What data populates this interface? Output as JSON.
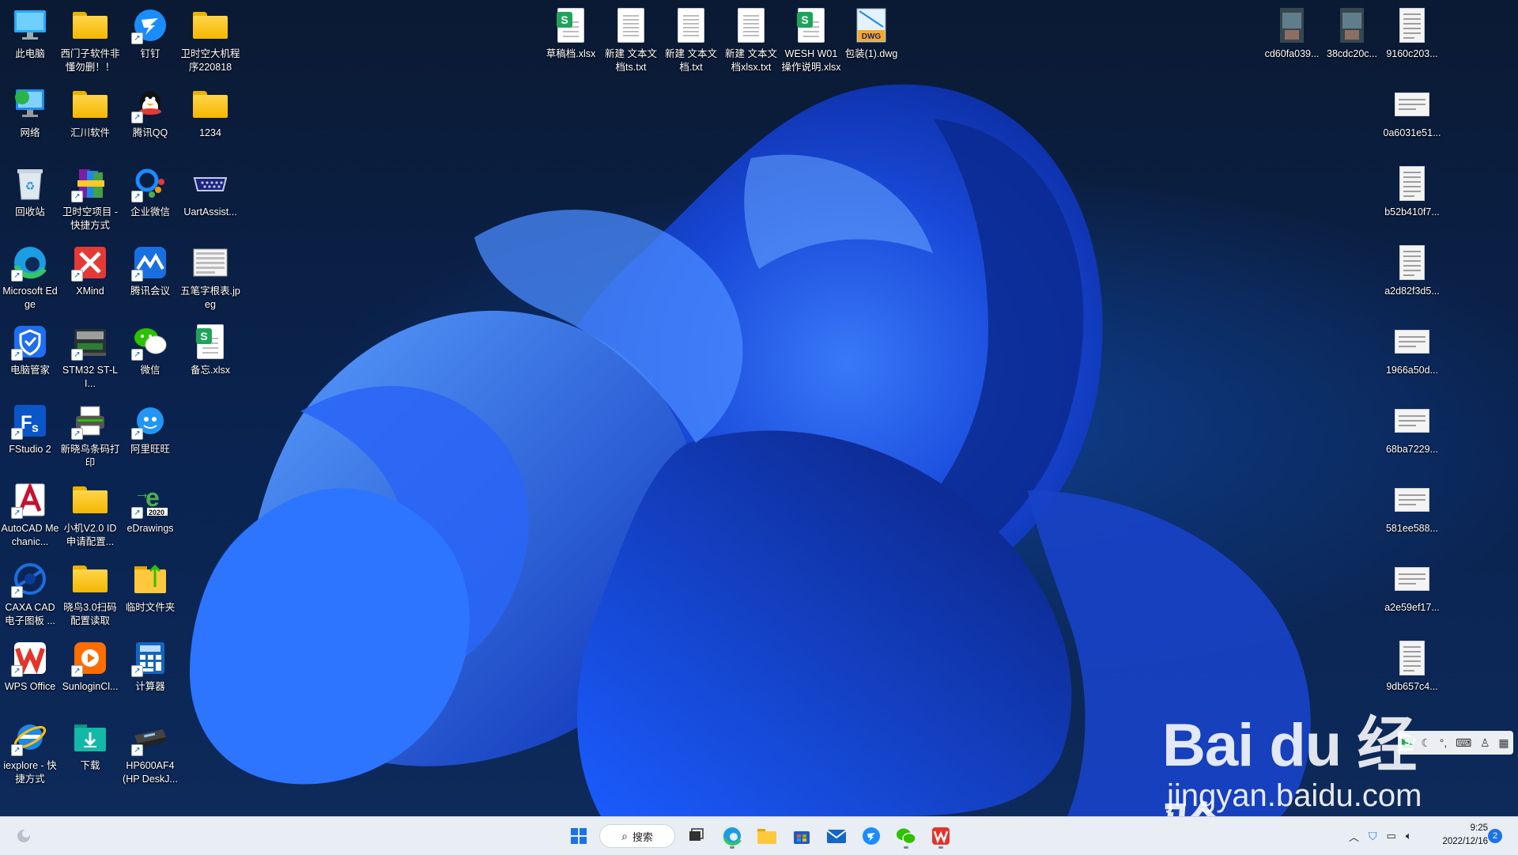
{
  "desktop": {
    "left_icons": [
      {
        "label": "此电脑",
        "icon": "computer-icon"
      },
      {
        "label": "网络",
        "icon": "network-icon"
      },
      {
        "label": "回收站",
        "icon": "recycle-bin-icon"
      },
      {
        "label": "Microsoft Edge",
        "icon": "edge-icon",
        "shortcut": true
      },
      {
        "label": "电脑管家",
        "icon": "pc-manager-icon",
        "shortcut": true
      },
      {
        "label": "FStudio 2",
        "icon": "fstudio-icon",
        "shortcut": true
      },
      {
        "label": "AutoCAD Mechanic...",
        "icon": "autocad-icon",
        "shortcut": true
      },
      {
        "label": "CAXA CAD 电子图板 ...",
        "icon": "caxa-icon",
        "shortcut": true
      },
      {
        "label": "WPS Office",
        "icon": "wps-icon",
        "shortcut": true
      },
      {
        "label": "iexplore - 快捷方式",
        "icon": "ie-icon",
        "shortcut": true
      },
      {
        "label": "西门子软件非懂勿删！！",
        "icon": "folder-icon"
      },
      {
        "label": "汇川软件",
        "icon": "folder-icon"
      },
      {
        "label": "卫时空项目 - 快捷方式",
        "icon": "winrar-icon",
        "shortcut": true
      },
      {
        "label": "XMind",
        "icon": "xmind-icon",
        "shortcut": true
      },
      {
        "label": "STM32 ST-LI...",
        "icon": "stlink-icon",
        "shortcut": true
      },
      {
        "label": "新晓鸟条码打印",
        "icon": "printer-icon",
        "shortcut": true
      },
      {
        "label": "小机V2.0 ID 申请配置...",
        "icon": "folder-icon"
      },
      {
        "label": "晓鸟3.0扫码配置读取",
        "icon": "folder-icon"
      },
      {
        "label": "SunloginCl...",
        "icon": "sunlogin-icon",
        "shortcut": true
      },
      {
        "label": "下载",
        "icon": "download-folder-icon"
      },
      {
        "label": "钉钉",
        "icon": "dingtalk-icon",
        "shortcut": true
      },
      {
        "label": "腾讯QQ",
        "icon": "qq-icon",
        "shortcut": true
      },
      {
        "label": "企业微信",
        "icon": "wecom-icon",
        "shortcut": true
      },
      {
        "label": "腾讯会议",
        "icon": "tencent-meeting-icon",
        "shortcut": true
      },
      {
        "label": "微信",
        "icon": "wechat-icon",
        "shortcut": true
      },
      {
        "label": "阿里旺旺",
        "icon": "aliwangwang-icon",
        "shortcut": true
      },
      {
        "label": "eDrawings",
        "icon": "edrawings-icon",
        "shortcut": true
      },
      {
        "label": "临时文件夹",
        "icon": "folder-upload-icon"
      },
      {
        "label": "计算器",
        "icon": "calculator-icon",
        "shortcut": true
      },
      {
        "label": "HP600AF4 (HP DeskJ...",
        "icon": "hp-printer-icon",
        "shortcut": true
      },
      {
        "label": "卫时空大机程序220818",
        "icon": "folder-icon"
      },
      {
        "label": "1234",
        "icon": "folder-icon"
      },
      {
        "label": "UartAssist...",
        "icon": "serial-port-icon"
      },
      {
        "label": "五笔字根表.jpeg",
        "icon": "image-file-icon"
      },
      {
        "label": "备忘.xlsx",
        "icon": "xlsx-file-icon"
      }
    ],
    "top_icons": [
      {
        "label": "草稿档.xlsx",
        "icon": "xlsx-file-icon"
      },
      {
        "label": "新建 文本文档ts.txt",
        "icon": "txt-file-icon"
      },
      {
        "label": "新建 文本文档.txt",
        "icon": "txt-file-icon"
      },
      {
        "label": "新建 文本文档xlsx.txt",
        "icon": "txt-file-icon"
      },
      {
        "label": "WESH W01操作说明.xlsx",
        "icon": "xlsx-file-icon"
      },
      {
        "label": "包装(1).dwg",
        "icon": "dwg-file-icon"
      }
    ],
    "right_top_icons": [
      {
        "label": "cd60fa039...",
        "icon": "photo-thumbnail-icon"
      },
      {
        "label": "38cdc20c...",
        "icon": "photo-thumbnail-icon"
      },
      {
        "label": "9160c203...",
        "icon": "document-thumbnail-icon"
      }
    ],
    "right_icons": [
      {
        "label": "0a6031e51...",
        "icon": "image-thumbnail-icon"
      },
      {
        "label": "b52b410f7...",
        "icon": "document-thumbnail-icon"
      },
      {
        "label": "a2d82f3d5...",
        "icon": "document-thumbnail-icon"
      },
      {
        "label": "1966a50d...",
        "icon": "image-thumbnail-icon"
      },
      {
        "label": "68ba7229...",
        "icon": "image-thumbnail-icon"
      },
      {
        "label": "581ee588...",
        "icon": "image-thumbnail-icon"
      },
      {
        "label": "a2e59ef17...",
        "icon": "image-thumbnail-icon"
      },
      {
        "label": "9db657c4...",
        "icon": "document-thumbnail-icon"
      }
    ]
  },
  "taskbar": {
    "search_label": "搜索",
    "apps": [
      {
        "name": "start-button",
        "icon": "windows-icon"
      },
      {
        "name": "task-view",
        "icon": "task-view-icon"
      },
      {
        "name": "edge",
        "icon": "edge-icon"
      },
      {
        "name": "file-explorer",
        "icon": "folder-icon"
      },
      {
        "name": "store",
        "icon": "store-icon"
      },
      {
        "name": "mail",
        "icon": "mail-icon"
      },
      {
        "name": "dingtalk",
        "icon": "dingtalk-icon"
      },
      {
        "name": "wechat",
        "icon": "wechat-icon"
      },
      {
        "name": "wps",
        "icon": "wps-icon"
      }
    ],
    "time": "9:25",
    "date": "2022/12/16",
    "notification_count": "2"
  },
  "watermark": {
    "main": "Bai du 经验",
    "sub": "jingyan.baidu.com"
  },
  "colors": {
    "accent": "#1a73e8",
    "taskbar_bg": "#e9edf4",
    "wallpaper_blue": "#1f4fe0"
  }
}
